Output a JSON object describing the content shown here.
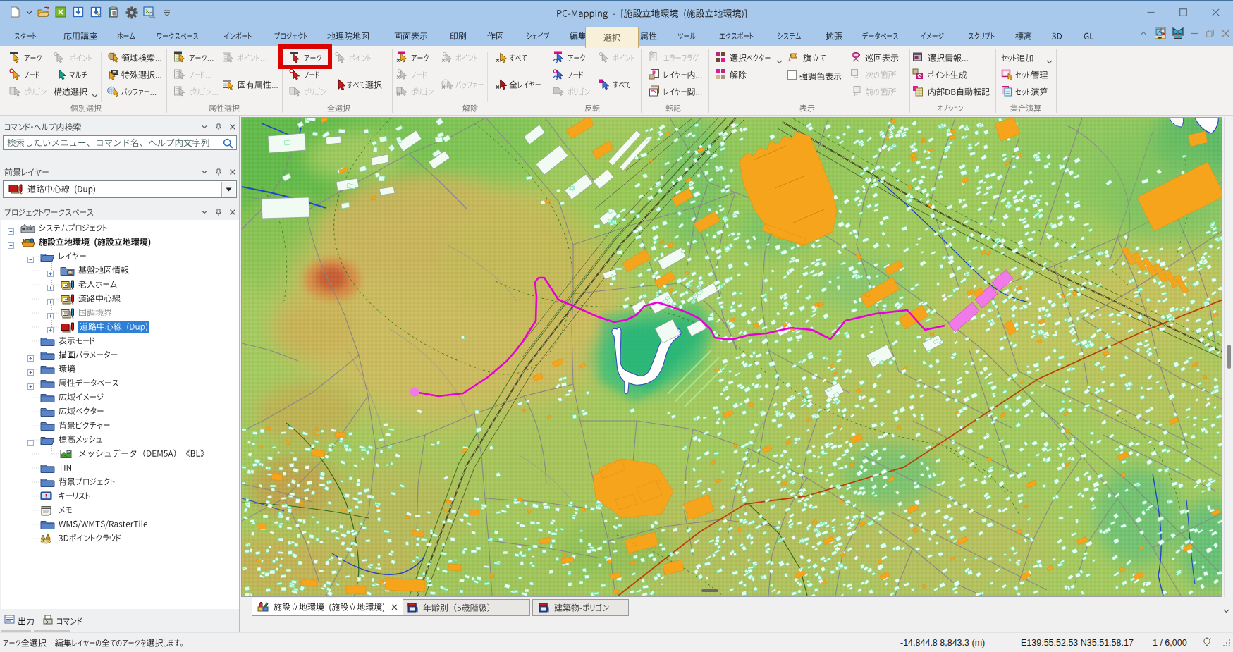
{
  "app": {
    "name": "PC-Mapping"
  },
  "colors": {
    "titlebar": "#a9c9ec",
    "active_tab": "#f8f0d8",
    "highlight_box": "#e00000",
    "selection": "#2e7fd6",
    "route": "#e800d8"
  },
  "quick_access_toolbar": {
    "buttons": [
      "new-document-button",
      "open-button",
      "excel-export-button",
      "import-button",
      "import-edit-button",
      "paste-special-button",
      "settings-button",
      "image-search-button"
    ]
  },
  "window": {
    "title": "PC-Mapping - [施設立地環境 (施設立地環境)]"
  },
  "ribbon": {
    "tabs": [
      {
        "active": false,
        "label": "スタート"
      },
      {
        "active": false,
        "label": "応用講座"
      },
      {
        "active": false,
        "label": "ホーム"
      },
      {
        "active": false,
        "label": "ワークスペース"
      },
      {
        "active": false,
        "label": "インポート"
      },
      {
        "active": false,
        "label": "プロジェクト"
      },
      {
        "active": false,
        "label": "地理院地図"
      },
      {
        "active": false,
        "label": "画面表示"
      },
      {
        "active": false,
        "label": "印刷"
      },
      {
        "active": false,
        "label": "作図"
      },
      {
        "active": false,
        "label": "シェイプ"
      },
      {
        "active": false,
        "label": "編集"
      },
      {
        "active": true,
        "label": "選択"
      },
      {
        "active": false,
        "label": "属性"
      },
      {
        "active": false,
        "label": "ツール"
      },
      {
        "active": false,
        "label": "エクスポート"
      },
      {
        "active": false,
        "label": "システム"
      },
      {
        "active": false,
        "label": "拡張"
      },
      {
        "active": false,
        "label": "データベース"
      },
      {
        "active": false,
        "label": "イメージ"
      },
      {
        "active": false,
        "label": "スクリプト"
      },
      {
        "active": false,
        "label": "標高"
      },
      {
        "active": false,
        "label": "3D"
      },
      {
        "active": false,
        "label": "GL"
      }
    ],
    "groups": [
      {
        "buttons": [
          {
            "label": "アーク",
            "enabled": true
          },
          {
            "label": "ポイント",
            "enabled": false
          },
          {
            "label": "ノード",
            "enabled": true
          },
          {
            "label": "マルチ",
            "enabled": true
          },
          {
            "label": "ポリゴン",
            "enabled": false
          },
          {
            "label": "構造選択",
            "enabled": true
          },
          {
            "label": "領域検索...",
            "enabled": true
          },
          {
            "label": "特殊選択...",
            "enabled": true
          },
          {
            "label": "バッファー...",
            "enabled": true
          }
        ],
        "label": "個別選択"
      },
      {
        "buttons": [
          {
            "label": "アーク...",
            "enabled": true
          },
          {
            "label": "ノード...",
            "enabled": false
          },
          {
            "label": "ポリゴン...",
            "enabled": false
          },
          {
            "label": "ポイント...",
            "enabled": false
          },
          {
            "label": "固有属性...",
            "enabled": true
          }
        ],
        "label": "属性選択"
      },
      {
        "buttons": [
          {
            "label": "アーク",
            "enabled": true
          },
          {
            "label": "ノード",
            "enabled": true
          },
          {
            "label": "ポリゴン",
            "enabled": false
          },
          {
            "label": "ポイント",
            "enabled": false
          },
          {
            "label": "すべて選択",
            "enabled": true
          }
        ],
        "label": "全選択"
      },
      {
        "buttons": [
          {
            "label": "アーク",
            "enabled": true
          },
          {
            "label": "ノード",
            "enabled": false
          },
          {
            "label": "ポリゴン",
            "enabled": false
          },
          {
            "label": "ポイント",
            "enabled": false
          },
          {
            "label": "バッファー",
            "enabled": false
          },
          {
            "label": "すべて",
            "enabled": true
          },
          {
            "label": "全レイヤー",
            "enabled": true
          }
        ],
        "label": "解除"
      },
      {
        "buttons": [
          {
            "label": "アーク",
            "enabled": true
          },
          {
            "label": "ノード",
            "enabled": true
          },
          {
            "label": "ポリゴン",
            "enabled": false
          },
          {
            "label": "ポイント",
            "enabled": false
          },
          {
            "label": "すべて",
            "enabled": true
          }
        ],
        "label": "反転"
      },
      {
        "buttons": [
          {
            "label": "エラーフラグ",
            "enabled": false
          },
          {
            "label": "レイヤー内...",
            "enabled": true
          },
          {
            "label": "レイヤー間...",
            "enabled": true
          }
        ],
        "label": "転記"
      },
      {
        "buttons": [
          {
            "label": "選択ベクター",
            "enabled": true
          },
          {
            "label": "解除",
            "enabled": true
          },
          {
            "label": "旗立て",
            "enabled": true
          },
          {
            "label": "強調色表示",
            "enabled": true,
            "checked": false
          },
          {
            "label": "巡回表示",
            "enabled": true
          },
          {
            "label": "次の箇所",
            "enabled": false
          },
          {
            "label": "前の箇所",
            "enabled": false
          }
        ],
        "label": "表示"
      },
      {
        "buttons": [
          {
            "label": "選択情報...",
            "enabled": true
          },
          {
            "label": "ポイント生成",
            "enabled": true
          },
          {
            "label": "内部DB自動転記",
            "enabled": true
          }
        ],
        "label": "オプション"
      },
      {
        "buttons": [
          {
            "label": "セット追加",
            "enabled": true
          },
          {
            "label": "セット管理",
            "enabled": true
          },
          {
            "label": "セット演算",
            "enabled": true
          }
        ],
        "label": "集合演算"
      }
    ],
    "highlight": {
      "group": "全選択",
      "button": "アーク"
    }
  },
  "panels": {
    "search": {
      "title": "コマンド・ヘルプ内検索",
      "placeholder": "検索したいメニュー、コマンド名、ヘルプ内文字列"
    },
    "foreground_layer": {
      "title": "前景レイヤー",
      "value": "道路中心線 (Dup)"
    },
    "workspace": {
      "title": "プロジェクトワークスペース",
      "tree": [
        {
          "label": "システムプロジェクト",
          "selected": false
        },
        {
          "label": "施設立地環境 (施設立地環境)",
          "selected": false
        },
        {
          "label": "レイヤー",
          "selected": false
        },
        {
          "label": "基盤地図情報",
          "selected": false
        },
        {
          "label": "老人ホーム",
          "selected": false
        },
        {
          "label": "道路中心線",
          "selected": false
        },
        {
          "label": "国調境界",
          "selected": false
        },
        {
          "label": "道路中心線 (Dup)",
          "selected": true
        },
        {
          "label": "表示モード",
          "selected": false
        },
        {
          "label": "描画パラメーター",
          "selected": false
        },
        {
          "label": "環境",
          "selected": false
        },
        {
          "label": "属性データベース",
          "selected": false
        },
        {
          "label": "広域イメージ",
          "selected": false
        },
        {
          "label": "広域ベクター",
          "selected": false
        },
        {
          "label": "背景ピクチャー",
          "selected": false
        },
        {
          "label": "標高メッシュ",
          "selected": false
        },
        {
          "label": "メッシュデータ（DEM5A）《BL》",
          "selected": false
        },
        {
          "label": "TIN",
          "selected": false
        },
        {
          "label": "背景プロジェクト",
          "selected": false
        },
        {
          "label": "キーリスト",
          "selected": false
        },
        {
          "label": "メモ",
          "selected": false
        },
        {
          "label": "WMS/WMTS/RasterTile",
          "selected": false
        },
        {
          "label": "3Dポイントクラウド",
          "selected": false
        }
      ]
    }
  },
  "sidebar_bottom_tabs": [
    {
      "label": "出力"
    },
    {
      "label": "コマンド"
    }
  ],
  "document_tabs": [
    {
      "label": "施設立地環境 (施設立地環境)",
      "active": true
    },
    {
      "label": "年齢別（5歳階級）",
      "active": false
    },
    {
      "label": "建築物-ポリゴン",
      "active": false
    }
  ],
  "status_bar": {
    "message": "アーク全選択　編集レイヤーの全てのアークを選択します。",
    "coordinates": "-14,844.8 8,843.3 (m)",
    "geo_coordinates": "E139:55:52.53 N35:51:58.17",
    "scale": "1 / 6,000"
  }
}
